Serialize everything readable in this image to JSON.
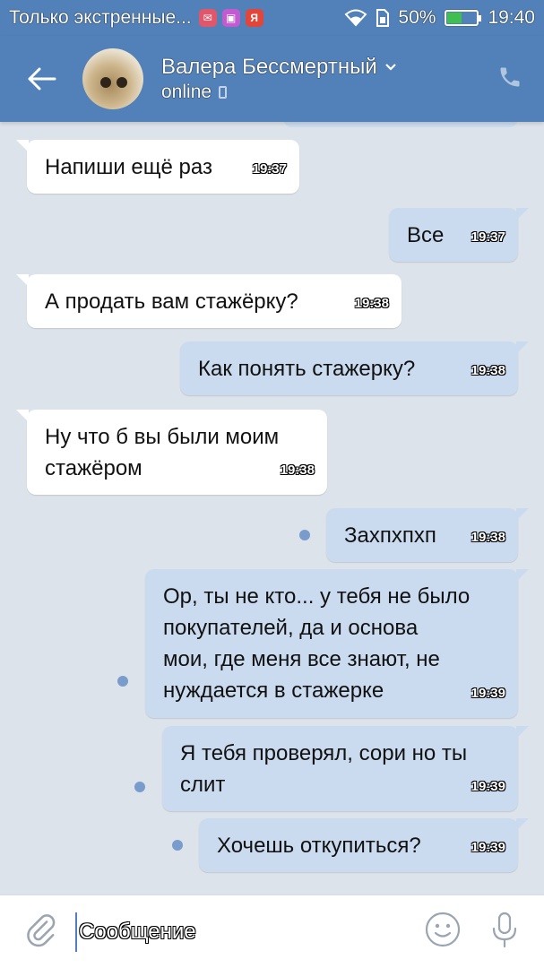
{
  "status_bar": {
    "notification_text": "Только экстренные...",
    "app_icons": [
      {
        "name": "mail-app-icon",
        "glyph": "✉",
        "color": "#e0566b"
      },
      {
        "name": "gallery-app-icon",
        "glyph": "▣",
        "color": "#c35bd0"
      },
      {
        "name": "yandex-app-icon",
        "glyph": "Я",
        "color": "#e2463a"
      }
    ],
    "battery_level": 50,
    "battery_text": "50%",
    "time": "19:40"
  },
  "header": {
    "contact_name": "Валера Бессмертный",
    "status": "online",
    "brand_color": "#5181b8"
  },
  "messages": [
    {
      "dir": "in",
      "text": "Напиши ещё раз",
      "time": "19:37"
    },
    {
      "dir": "out",
      "text": "Все",
      "time": "19:37"
    },
    {
      "dir": "in",
      "text": "А продать вам стажёрку?",
      "time": "19:38"
    },
    {
      "dir": "out",
      "text": "Как понять стажерку?",
      "time": "19:38"
    },
    {
      "dir": "in",
      "text": "Ну что б вы были моим\nстажёром",
      "time": "19:38"
    },
    {
      "dir": "out",
      "text": "Захпхпхп",
      "time": "19:38",
      "unread": true
    },
    {
      "dir": "out",
      "text": "Ор, ты не кто... у тебя не было\nпокупателей, да и основа\nмои, где меня все знают, не\nнуждается в стажерке",
      "time": "19:39",
      "unread": true
    },
    {
      "dir": "out",
      "text": "Я тебя проверял, сори но ты\nслит",
      "time": "19:39",
      "unread": true
    },
    {
      "dir": "out",
      "text": "Хочешь откупиться?",
      "time": "19:39",
      "unread": true
    }
  ],
  "composer": {
    "placeholder": "Сообщение"
  }
}
